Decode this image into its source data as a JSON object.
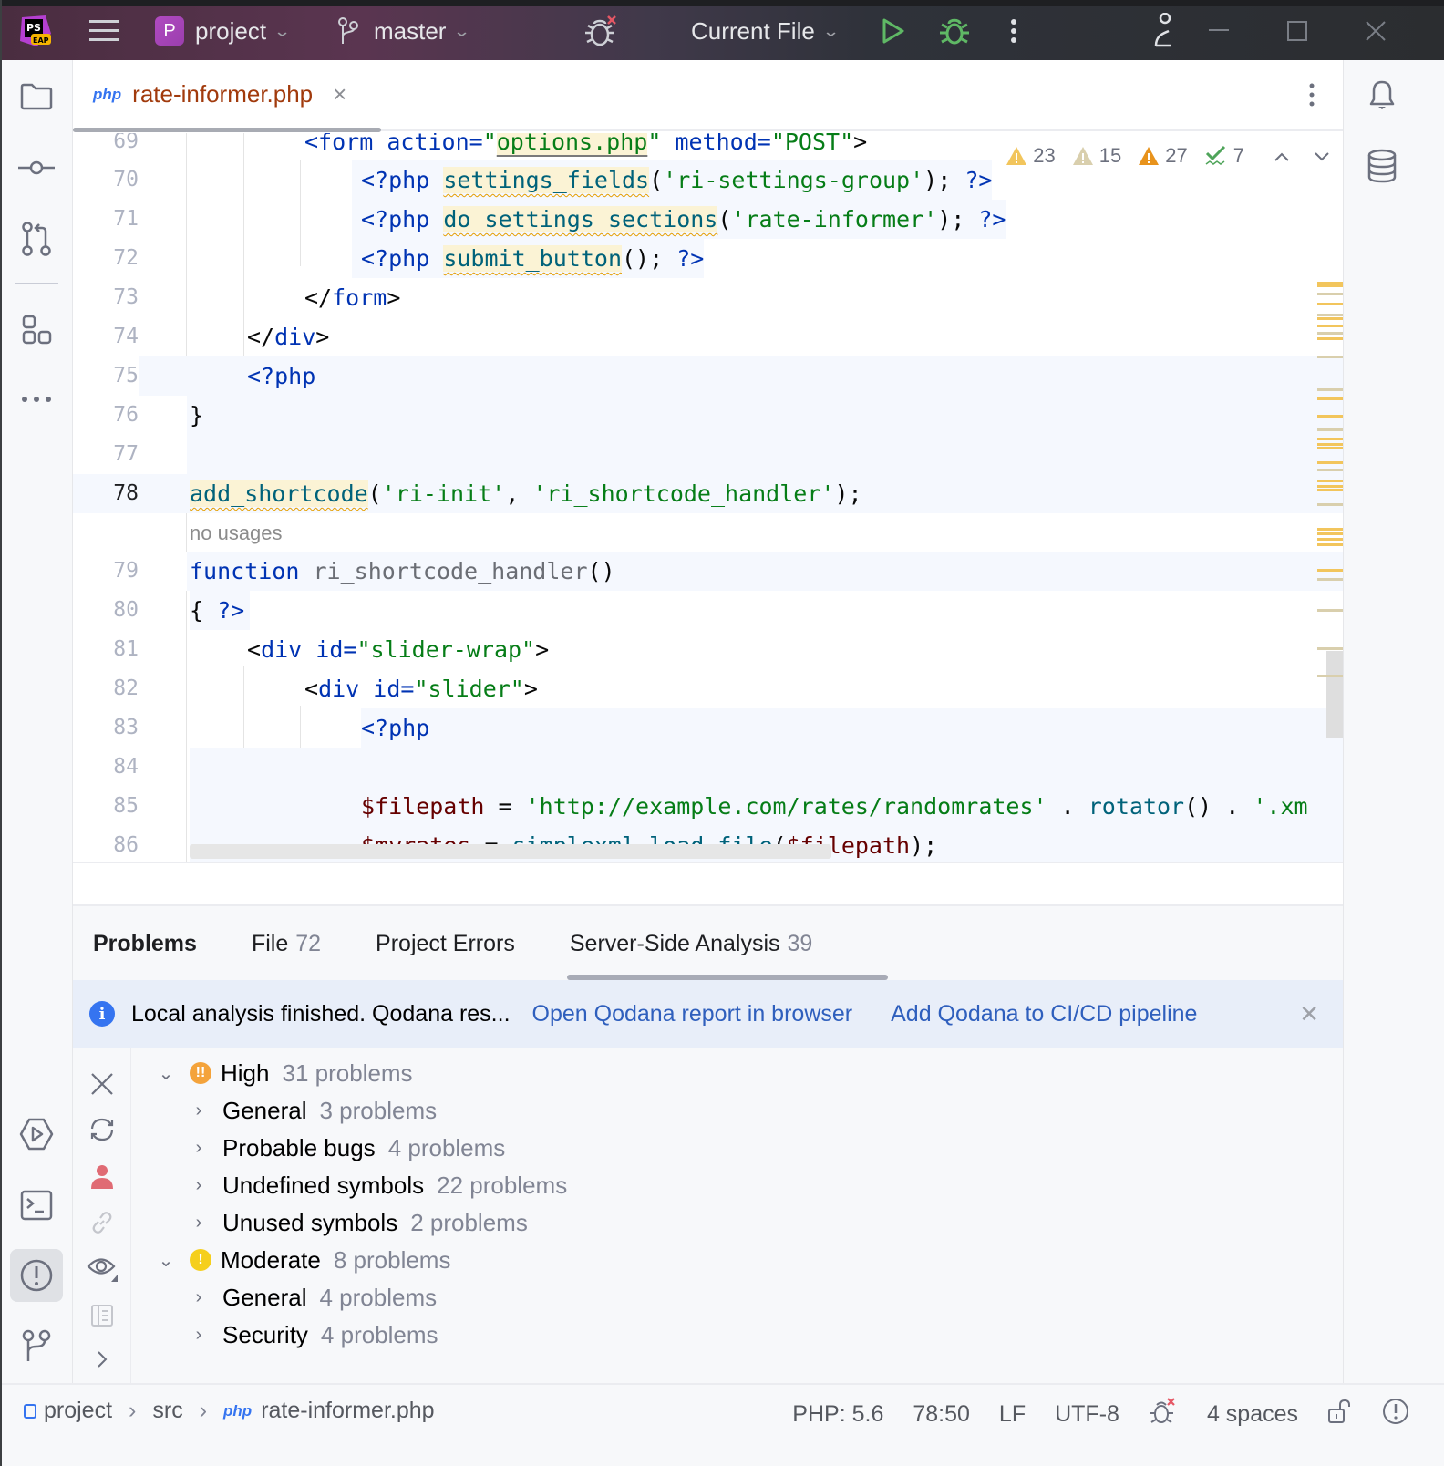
{
  "titlebar": {
    "app_logo": "PS EAP",
    "project_badge": "P",
    "project_name": "project",
    "branch": "master",
    "run_config": "Current File"
  },
  "editor": {
    "tab": {
      "icon": "php",
      "filename": "rate-informer.php"
    },
    "inspections": {
      "warnings_a": "23",
      "warnings_b": "15",
      "warnings_c": "27",
      "ok": "7"
    },
    "lines": [
      {
        "n": "69",
        "text": "<form action=\"options.php\" method=\"POST\">"
      },
      {
        "n": "70",
        "text": "<?php settings_fields('ri-settings-group'); ?>"
      },
      {
        "n": "71",
        "text": "<?php do_settings_sections('rate-informer'); ?>"
      },
      {
        "n": "72",
        "text": "<?php submit_button(); ?>"
      },
      {
        "n": "73",
        "text": "</form>"
      },
      {
        "n": "74",
        "text": "</div>"
      },
      {
        "n": "75",
        "text": "<?php"
      },
      {
        "n": "76",
        "text": "}"
      },
      {
        "n": "77",
        "text": ""
      },
      {
        "n": "78",
        "text": "add_shortcode('ri-init', 'ri_shortcode_handler');"
      },
      {
        "n": "",
        "text": "no usages"
      },
      {
        "n": "79",
        "text": "function ri_shortcode_handler()"
      },
      {
        "n": "80",
        "text": "{ ?>"
      },
      {
        "n": "81",
        "text": "<div id=\"slider-wrap\">"
      },
      {
        "n": "82",
        "text": "<div id=\"slider\">"
      },
      {
        "n": "83",
        "text": "<?php"
      },
      {
        "n": "84",
        "text": ""
      },
      {
        "n": "85",
        "text": "$filepath = 'http://example.com/rates/randomrates' . rotator() . '.xm"
      },
      {
        "n": "86",
        "text": "$myrates = simplexml_load_file($filepath);"
      }
    ],
    "tokens": {
      "l69": [
        "<form",
        " action=",
        "\"",
        "options.php",
        "\"",
        " method=",
        "\"POST\"",
        ">"
      ],
      "l70": [
        "<?php",
        " ",
        "settings_fields",
        "(",
        "'ri-settings-group'",
        ");",
        " ?>"
      ],
      "l71": [
        "<?php",
        " ",
        "do_settings_sections",
        "(",
        "'rate-informer'",
        ");",
        " ?>"
      ],
      "l72": [
        "<?php",
        " ",
        "submit_button",
        "();",
        " ?>"
      ],
      "l73": [
        "</",
        "form",
        ">"
      ],
      "l74": [
        "</",
        "div",
        ">"
      ],
      "l75": [
        "<?php"
      ],
      "l76": [
        "}"
      ],
      "l78": [
        "add_shortcode",
        "(",
        "'ri-init'",
        ", ",
        "'ri_shortcode_handler'",
        ");"
      ],
      "l78_hint": "no usages",
      "l79": [
        "function",
        " ",
        "ri_shortcode_handler",
        "()"
      ],
      "l80": [
        "{ ",
        "?>"
      ],
      "l81": [
        "<",
        "div",
        " id=",
        "\"slider-wrap\"",
        ">"
      ],
      "l82": [
        "<",
        "div",
        " id=",
        "\"slider\"",
        ">"
      ],
      "l83": [
        "<?php"
      ],
      "l85": [
        "$filepath",
        " = ",
        "'http://example.com/rates/randomrates'",
        " . ",
        "rotator",
        "()",
        " . ",
        "'.xm"
      ],
      "l86": [
        "$myrates",
        " = ",
        "simplexml_load_file",
        "(",
        "$filepath",
        ");"
      ]
    }
  },
  "problems": {
    "tabs": [
      {
        "label": "Problems",
        "count": ""
      },
      {
        "label": "File",
        "count": "72"
      },
      {
        "label": "Project Errors",
        "count": ""
      },
      {
        "label": "Server-Side Analysis",
        "count": "39"
      }
    ],
    "banner": {
      "message": "Local analysis finished. Qodana res...",
      "link1": "Open Qodana report in browser",
      "link2": "Add Qodana to CI/CD pipeline"
    },
    "tree": [
      {
        "level": 0,
        "label": "High",
        "count": "31 problems",
        "severity": "high",
        "expanded": true
      },
      {
        "level": 1,
        "label": "General",
        "count": "3 problems"
      },
      {
        "level": 1,
        "label": "Probable bugs",
        "count": "4 problems"
      },
      {
        "level": 1,
        "label": "Undefined symbols",
        "count": "22 problems"
      },
      {
        "level": 1,
        "label": "Unused symbols",
        "count": "2 problems"
      },
      {
        "level": 0,
        "label": "Moderate",
        "count": "8 problems",
        "severity": "moderate",
        "expanded": true
      },
      {
        "level": 1,
        "label": "General",
        "count": "4 problems"
      },
      {
        "level": 1,
        "label": "Security",
        "count": "4 problems"
      }
    ]
  },
  "statusbar": {
    "breadcrumb": [
      "project",
      "src",
      "rate-informer.php"
    ],
    "php_version": "PHP: 5.6",
    "caret": "78:50",
    "line_sep": "LF",
    "encoding": "UTF-8",
    "indent": "4 spaces"
  },
  "colors": {
    "warning": "#f2c55c",
    "weak_warning": "#d9cfad",
    "strong_warning": "#e8931c",
    "ok": "#4fa45a",
    "accent": "#3574f0",
    "high": "#f4a33b",
    "moderate": "#f5cf1c"
  }
}
